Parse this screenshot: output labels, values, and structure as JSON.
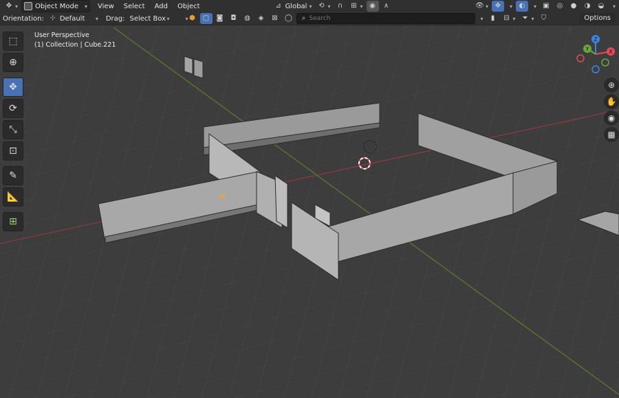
{
  "header": {
    "mode_label": "Object Mode",
    "menus": [
      "View",
      "Select",
      "Add",
      "Object"
    ],
    "transform_orientation": "Global"
  },
  "tool_header": {
    "orientation_label": "Orientation:",
    "orientation_value": "Default",
    "drag_label": "Drag:",
    "drag_value": "Select Box",
    "search_placeholder": "Search",
    "options_label": "Options"
  },
  "viewport": {
    "view_name": "User Perspective",
    "collection_info": "(1) Collection | Cube.221"
  },
  "toolbar": {
    "tools": [
      "select-box",
      "cursor",
      "move",
      "rotate",
      "scale",
      "transform",
      "annotate",
      "measure",
      "add-cube"
    ],
    "active_tool": "move"
  },
  "gizmo": {
    "axes": [
      "X",
      "Y",
      "Z"
    ],
    "colors": {
      "x": "#e44b5a",
      "y": "#6da83a",
      "z": "#3a88e4"
    }
  },
  "colors": {
    "accent": "#4772b3",
    "header_bg": "#303030",
    "viewport_bg": "#3d3d3d"
  }
}
